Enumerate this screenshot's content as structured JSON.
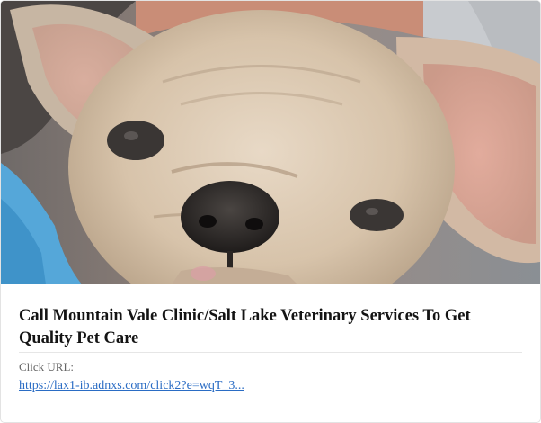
{
  "card": {
    "image": {
      "subject": "cream french bulldog puppy close-up"
    },
    "title": "Call Mountain Vale Clinic/Salt Lake Veterinary Services To Get Quality Pet Care",
    "click_url_label": "Click URL:",
    "click_url": "https://lax1-ib.adnxs.com/click2?e=wqT_3..."
  },
  "colors": {
    "title": "#141414",
    "label": "#666666",
    "link": "#2a6cc4",
    "border": "#e3e3e3"
  }
}
